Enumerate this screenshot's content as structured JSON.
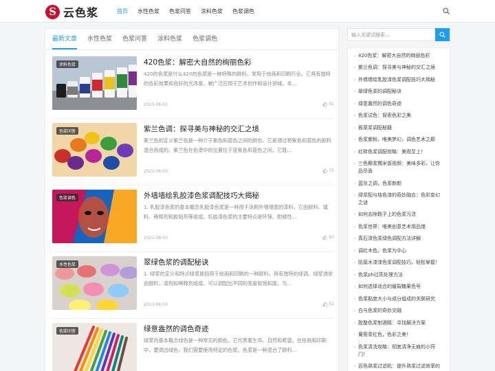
{
  "header": {
    "logo_mark": "S",
    "logo_text": "云色浆",
    "nav": [
      "首页",
      "水性色浆",
      "色浆问答",
      "涂料色浆",
      "色浆调色"
    ]
  },
  "tabs": [
    "最新文章",
    "水性色浆",
    "色浆问答",
    "涂料色浆",
    "色浆调色"
  ],
  "articles": [
    {
      "badge": "涂料色浆",
      "title": "420色浆：解密大自然的绚丽色彩",
      "excerpt": "420的色浆是什么420的色浆是一种特殊的颜料，常用于绘画和印刷行业。它具有独特的色彩效果和良好的光泽度，被广泛应用于艺术创作和设计领域。本...",
      "date": "2023-08-03",
      "likes": "92"
    },
    {
      "badge": "色浆问答",
      "title": "紫兰色调：探寻美与神秘的交汇之境",
      "excerpt": "紫兰色的定义紫兰色是一种介于紫色和蓝色之间的颜色，它是通过将紫色和蓝色的颜料混合而成的。紫兰色在色谱中的位置位于蓝紫色和蓝色之间，它既...",
      "date": "2023-08-03",
      "likes": "72"
    },
    {
      "badge": "色浆调色",
      "title": "外墙墙绘乳胶漆色浆调配技巧大揭秘",
      "excerpt": "1. 乳胶漆色浆的基本概念乳胶漆色浆是一种用于涂刷外墙墙面的漆料，它由颜料、填料、稀释剂和胶粘剂等组成。乳胶漆色浆的主要特点是环保、耐候性...",
      "date": "2023-08-03",
      "likes": "87"
    },
    {
      "badge": "水性色浆",
      "title": "翠绿色浆的调配秘诀",
      "excerpt": "1. 绿浆的定义和特点绿浆是指用于绘画和印刷的一种颜料，具有独特的绿调。绿浆通常由颜料、溶剂和稀释剂组成，可以调配出不同的亮度和饱和度。与...",
      "date": "2023-08-03",
      "likes": "51"
    },
    {
      "badge": "色浆问答",
      "title": "绿意盎然的调色奇迹",
      "excerpt": "绿浆的基本概念绿色是一种常见的颜色，它代表着生命、自然和希望。在绘画和印刷中，要调出绿色，我们需要使用特定的色浆。色浆是一种混合了颜料...",
      "date": "",
      "likes": ""
    }
  ],
  "sidebar": {
    "search_placeholder": "输入关键词搜索...",
    "items": [
      "420色浆：解密大自然的绚丽色彩",
      "紫兰色调：探寻美与神秘的交汇之境",
      "外墙墙绘乳胶漆色浆调配技巧大揭秘",
      "翠绿色浆的调配秘诀",
      "绿意盎然的调色奇迹",
      "色浆试色：探索色彩之美",
      "板栗浆调配秘籍",
      "色浆紫粉，唯美梦幻，调色艺术之巅",
      "红砖色浆调配攻略：美观至上！",
      "三色椰浆糯米饭视频：美味多彩，让你品尽香",
      "蓝灰之调，色浆新颜",
      "绿浆配与桔色漆的奇妙融合：色彩变幻之谜",
      "如何去除鞋子上的色浆污渍",
      "色浆世界：唯美创意艺术用品馆",
      "真石漆色浆绿色调配方法详解",
      "调红木色，色浆为中心",
      "防腐木漆漆色浆调配技巧，轻松掌握！",
      "色浆ph过高处理方法",
      "如何选择适合的缓裂糖果色号",
      "色浆黏度大小与成分组成的关联研究",
      "白与色浆的奇妙交融",
      "胶整色浆制酒精：寻找解决方案",
      "葡萄浆红色，色彩之美！",
      "色浆清洗攻略：彻底清净无痕的小窍门！",
      "百色熟浆过滤机：提升熟浆过滤效率的选择"
    ]
  },
  "colors": {
    "accent": "#1e9ef0",
    "logo": "#c8102e"
  }
}
